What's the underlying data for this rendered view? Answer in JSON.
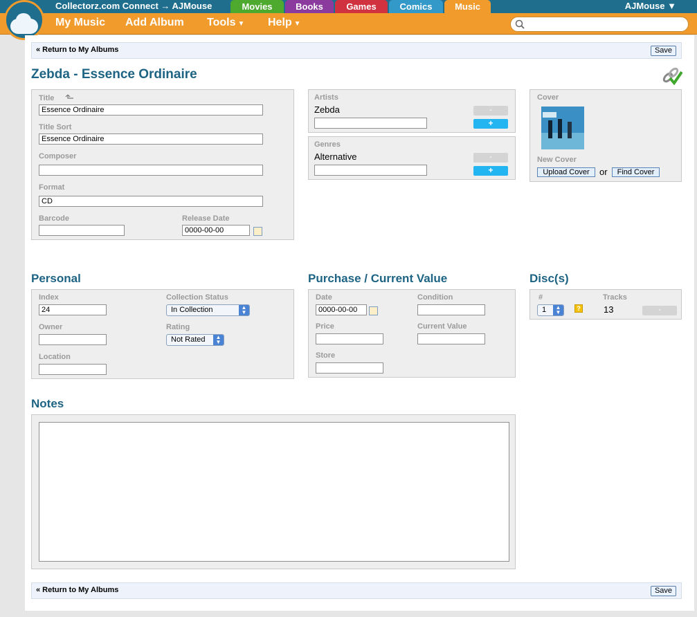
{
  "header": {
    "site_title": "Collectorz.com Connect → AJMouse",
    "tabs": [
      {
        "label": "Movies",
        "color": "#4eaa2f"
      },
      {
        "label": "Books",
        "color": "#8b3a9e"
      },
      {
        "label": "Games",
        "color": "#d1323f"
      },
      {
        "label": "Comics",
        "color": "#3399c9"
      },
      {
        "label": "Music",
        "color": "#f19b2c"
      }
    ],
    "user": "AJMouse ▼"
  },
  "nav": {
    "my_music": "My Music",
    "add_album": "Add Album",
    "tools": "Tools",
    "help": "Help",
    "caret": "▼"
  },
  "search": {
    "icon": "search-icon",
    "placeholder": ""
  },
  "actions": {
    "return": "« Return to My Albums",
    "save": "Save"
  },
  "album_title": "Zebda - Essence Ordinaire",
  "main": {
    "title_label": "Title",
    "title_value": "Essence Ordinaire",
    "title_sort_label": "Title Sort",
    "title_sort_value": "Essence Ordinaire",
    "composer_label": "Composer",
    "composer_value": "",
    "format_label": "Format",
    "format_value": "CD",
    "barcode_label": "Barcode",
    "barcode_value": "",
    "release_date_label": "Release Date",
    "release_date_value": "0000-00-00"
  },
  "artists": {
    "label": "Artists",
    "value": "Zebda",
    "minus": "-",
    "plus": "+"
  },
  "genres": {
    "label": "Genres",
    "value": "Alternative",
    "minus": "-",
    "plus": "+"
  },
  "cover": {
    "label": "Cover",
    "new_cover_label": "New Cover",
    "upload": "Upload Cover",
    "or": "or",
    "find": "Find Cover"
  },
  "personal": {
    "heading": "Personal",
    "index_label": "Index",
    "index_value": "24",
    "collection_status_label": "Collection Status",
    "collection_status_value": "In Collection",
    "owner_label": "Owner",
    "owner_value": "",
    "rating_label": "Rating",
    "rating_value": "Not Rated",
    "location_label": "Location",
    "location_value": ""
  },
  "purchase": {
    "heading": "Purchase / Current Value",
    "date_label": "Date",
    "date_value": "0000-00-00",
    "condition_label": "Condition",
    "condition_value": "",
    "price_label": "Price",
    "price_value": "",
    "current_value_label": "Current Value",
    "current_value_value": "",
    "store_label": "Store",
    "store_value": ""
  },
  "discs": {
    "heading": "Disc(s)",
    "num_label": "#",
    "num_value": "1",
    "help": "?",
    "tracks_label": "Tracks",
    "tracks_value": "13",
    "minus": "-"
  },
  "notes": {
    "heading": "Notes",
    "value": ""
  }
}
